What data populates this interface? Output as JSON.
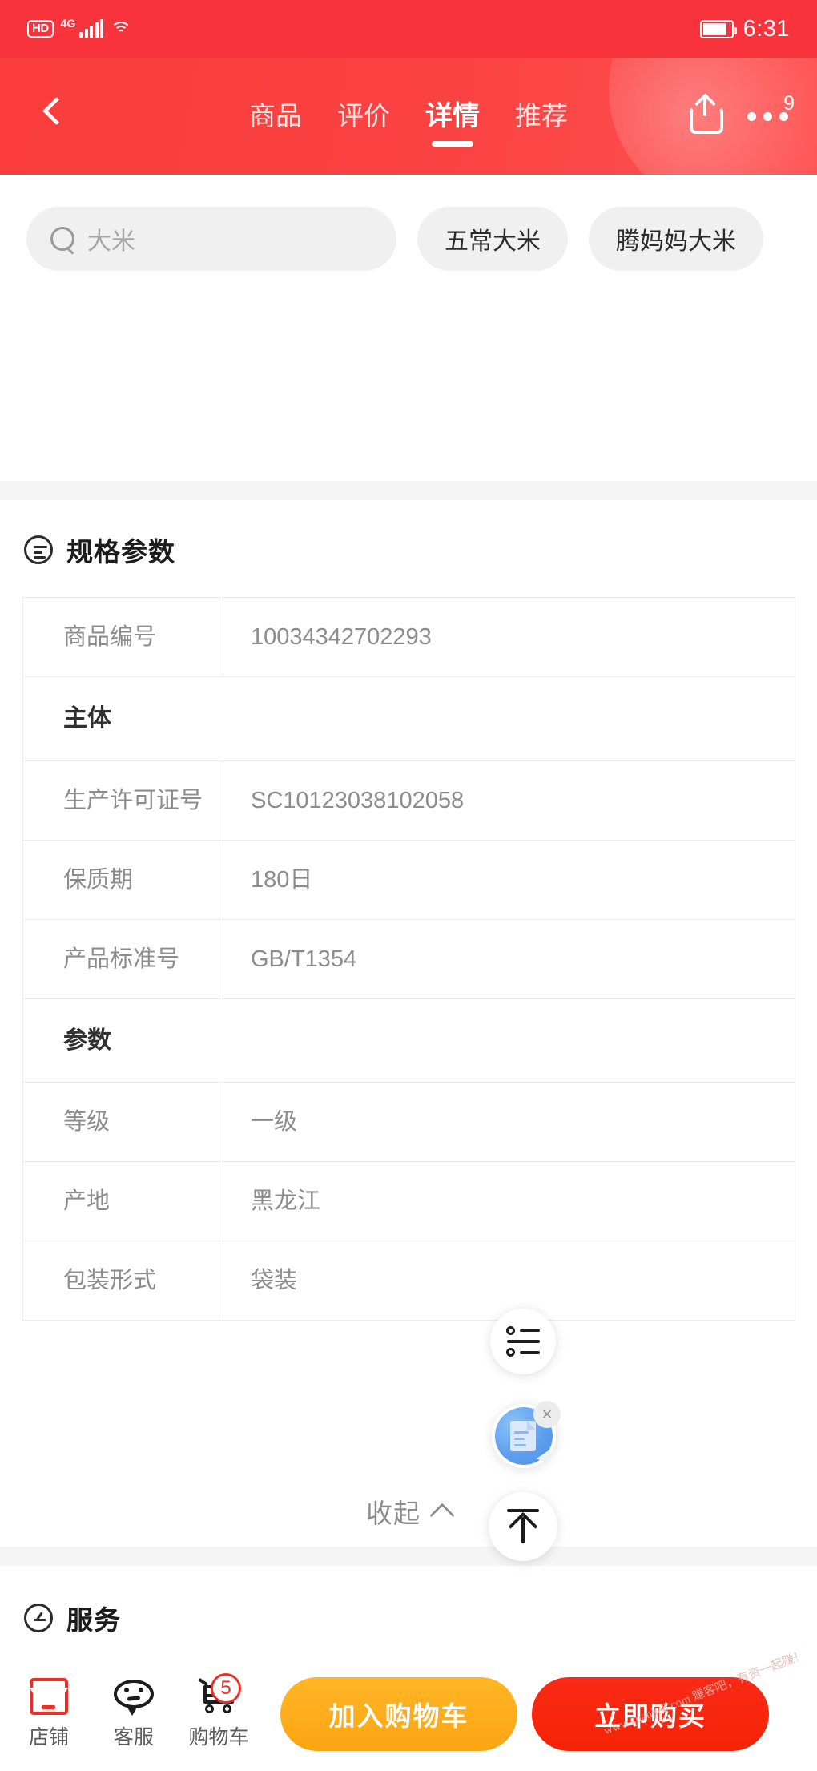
{
  "statusbar": {
    "hd": "HD",
    "network": "4G",
    "time": "6:31"
  },
  "navbar": {
    "back_icon": "chevron-left-icon",
    "tabs": [
      {
        "label": "商品",
        "active": false
      },
      {
        "label": "评价",
        "active": false
      },
      {
        "label": "详情",
        "active": true
      },
      {
        "label": "推荐",
        "active": false
      }
    ],
    "share_icon": "share-icon",
    "more_icon": "more-dots-icon",
    "more_badge": "9"
  },
  "search": {
    "placeholder": "大米",
    "icon": "search-icon",
    "chips": [
      "五常大米",
      "腾妈妈大米"
    ]
  },
  "spec": {
    "icon": "spec-list-icon",
    "title": "规格参数",
    "rows": [
      {
        "type": "kv",
        "key": "商品编号",
        "value": "10034342702293"
      },
      {
        "type": "group",
        "key": "主体",
        "value": ""
      },
      {
        "type": "kv",
        "key": "生产许可证号",
        "value": "SC10123038102058"
      },
      {
        "type": "kv",
        "key": "保质期",
        "value": "180日"
      },
      {
        "type": "kv",
        "key": "产品标准号",
        "value": "GB/T1354"
      },
      {
        "type": "group",
        "key": "参数",
        "value": ""
      },
      {
        "type": "kv",
        "key": "等级",
        "value": "一级"
      },
      {
        "type": "kv",
        "key": "产地",
        "value": "黑龙江"
      },
      {
        "type": "kv",
        "key": "包装形式",
        "value": "袋装"
      }
    ],
    "collapse_label": "收起",
    "collapse_icon": "chevron-up-icon"
  },
  "service": {
    "icon": "service-icon",
    "title": "服务"
  },
  "floating": {
    "list_icon": "list-options-icon",
    "doc_icon": "document-edit-icon",
    "doc_close_icon": "close-icon",
    "doc_close_label": "×",
    "top_icon": "scroll-to-top-icon"
  },
  "bottombar": {
    "items": [
      {
        "label": "店铺",
        "icon": "shop-icon",
        "badge": ""
      },
      {
        "label": "客服",
        "icon": "customer-service-icon",
        "badge": ""
      },
      {
        "label": "购物车",
        "icon": "cart-icon",
        "badge": "5"
      }
    ],
    "add_to_cart": "加入购物车",
    "buy_now": "立即购买"
  },
  "watermark": "www.zuanke8.com 赚客吧，有资一起赚！",
  "colors": {
    "brand_red": "#fa3c3c",
    "cart_orange": "#ffb625",
    "buy_red": "#f52305",
    "badge_red": "#ee2e24"
  }
}
